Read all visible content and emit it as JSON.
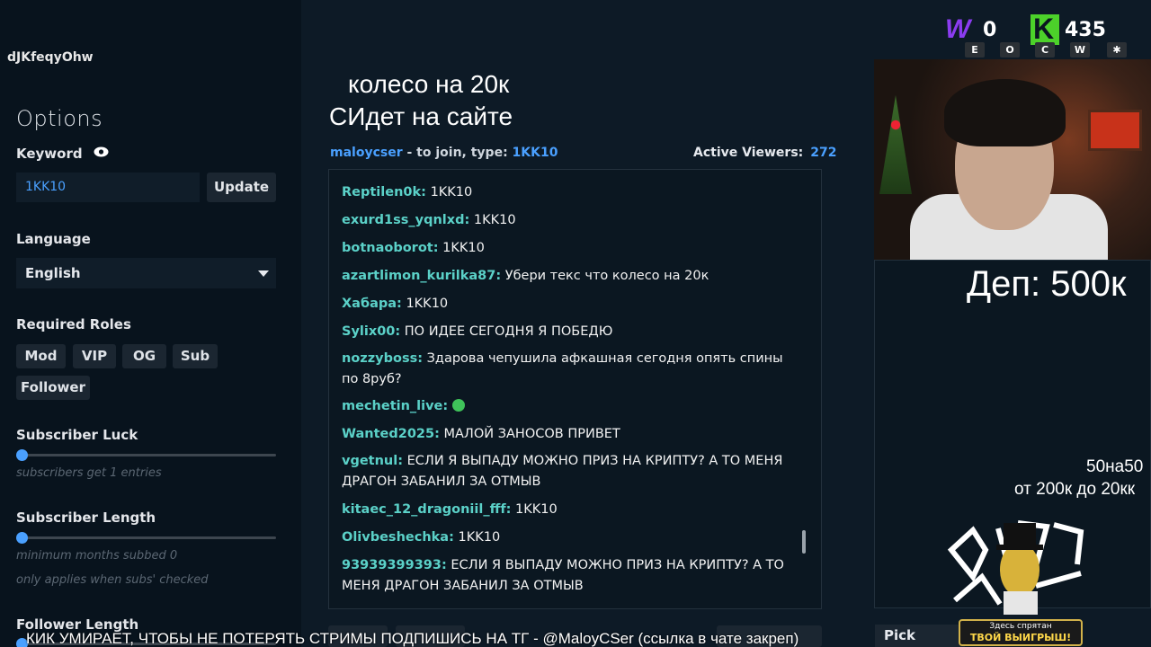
{
  "left": {
    "channel": "dJKfeqyOhw",
    "options_title": "Options",
    "keyword_label": "Keyword",
    "keyword_value": "1KK10",
    "update_label": "Update",
    "language_label": "Language",
    "language_value": "English",
    "roles_label": "Required Roles",
    "roles": [
      "Mod",
      "VIP",
      "OG",
      "Sub",
      "Follower"
    ],
    "sub_luck_label": "Subscriber Luck",
    "sub_luck_hint": "subscribers get 1 entries",
    "sub_length_label": "Subscriber Length",
    "sub_length_hint": "minimum months subbed 0",
    "sub_length_hint2": "only applies when subs' checked",
    "follower_length_label": "Follower Length"
  },
  "overlay": {
    "line1": "колесо на 20к",
    "line2": "Идет на сайте",
    "line2_prefix": "C"
  },
  "chat": {
    "channel": "maloycser",
    "join_text": " - to join, type: ",
    "join_code": "1KK10",
    "viewers_label": "Active Viewers:",
    "viewers_count": "272",
    "messages": [
      {
        "user": "Reptilen0k:",
        "text": "1KK10"
      },
      {
        "user": "exurd1ss_yqnlxd:",
        "text": "1KK10"
      },
      {
        "user": "botnaoborot:",
        "text": "1KK10"
      },
      {
        "user": "azartlimon_kurilka87:",
        "text": "Убери текс что колесо на 20к"
      },
      {
        "user": "Xaбapa:",
        "text": "1KK10"
      },
      {
        "user": "Sylix00:",
        "text": "ПО ИДЕЕ СЕГОДНЯ Я ПОБЕДЮ"
      },
      {
        "user": "nozzyboss:",
        "text": "Здарова чепушила афкашная сегодня опять спины по 8руб?"
      },
      {
        "user": "mechetin_live:",
        "text": ""
      },
      {
        "user": "Wanted2025:",
        "text": "МАЛОЙ ЗАНОСОВ ПРИВЕТ"
      },
      {
        "user": "vgetnul:",
        "text": "ЕСЛИ Я ВЫПАДУ МОЖНО ПРИЗ НА КРИПТУ? А ТО МЕНЯ ДРАГОН ЗАБАНИЛ ЗА ОТМЫВ"
      },
      {
        "user": "kitaec_12_dragoniil_fff:",
        "text": "1KK10"
      },
      {
        "user": "Olivbeshechka:",
        "text": "1KK10"
      },
      {
        "user": "93939399393:",
        "text": "ЕСЛИ Я ВЫПАДУ МОЖНО ПРИЗ НА КРИПТУ? А ТО МЕНЯ ДРАГОН ЗАБАНИЛ ЗА ОТМЫВ"
      }
    ]
  },
  "right": {
    "deposit": "Деп: 500к",
    "line_50": "50на50",
    "line_range": "от 200к до 20кк",
    "pick_winner": "Pick Winne",
    "promo_small": "Здесь спрятан",
    "promo_big": "ТВОЙ ВЫИГРЫШ!"
  },
  "counters": {
    "w_badge": "W",
    "w_count": "0",
    "k_badge": "K",
    "k_count": "435",
    "keys": [
      "E",
      "O",
      "C",
      "W",
      "✱"
    ]
  },
  "ticker": "КИК УМИРАЕТ, ЧТОБЫ НЕ ПОТЕРЯТЬ СТРИМЫ ПОДПИШИСЬ НА ТГ - @MaloyCSer (ссылка в чате закреп)"
}
